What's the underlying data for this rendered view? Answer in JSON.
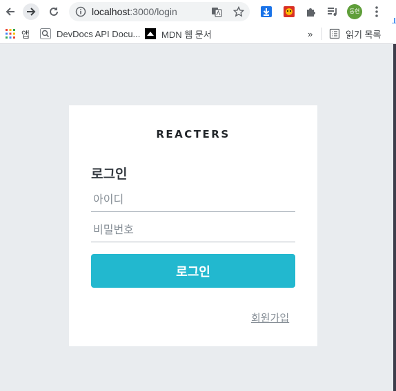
{
  "browser": {
    "url_host": "localhost",
    "url_path": ":3000/login",
    "avatar_label": "동현"
  },
  "bookmarks": {
    "apps_label": "앱",
    "items": [
      "DevDocs API Docu...",
      "MDN 웹 문서"
    ],
    "more_label": "»",
    "reading_list_label": "읽기 목록"
  },
  "auth": {
    "brand": "REACTERS",
    "title": "로그인",
    "username_placeholder": "아이디",
    "password_placeholder": "비밀번호",
    "submit_label": "로그인",
    "signup_link": "회원가입",
    "accent_color": "#22b8cf"
  }
}
